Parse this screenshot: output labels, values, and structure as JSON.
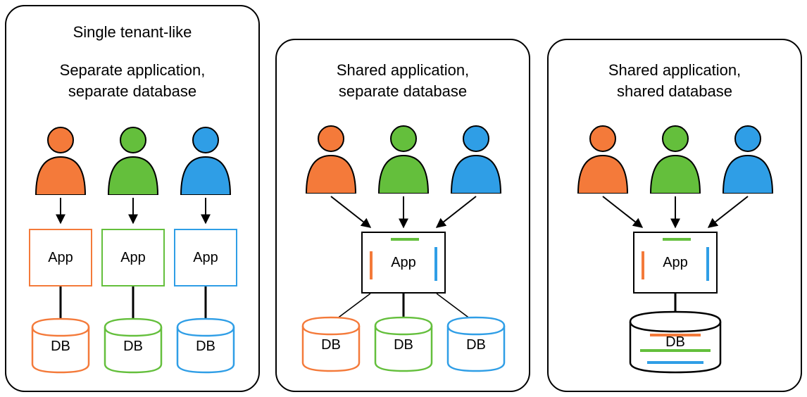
{
  "colors": {
    "orange": "#f47a3a",
    "green": "#64bf3c",
    "blue": "#2f9ee6"
  },
  "labels": {
    "app": "App",
    "db": "DB"
  },
  "panels": [
    {
      "title1": "Single tenant-like",
      "title2": "Separate application,\nseparate database"
    },
    {
      "title": "Shared application,\nseparate database"
    },
    {
      "title": "Shared application,\nshared database"
    }
  ]
}
